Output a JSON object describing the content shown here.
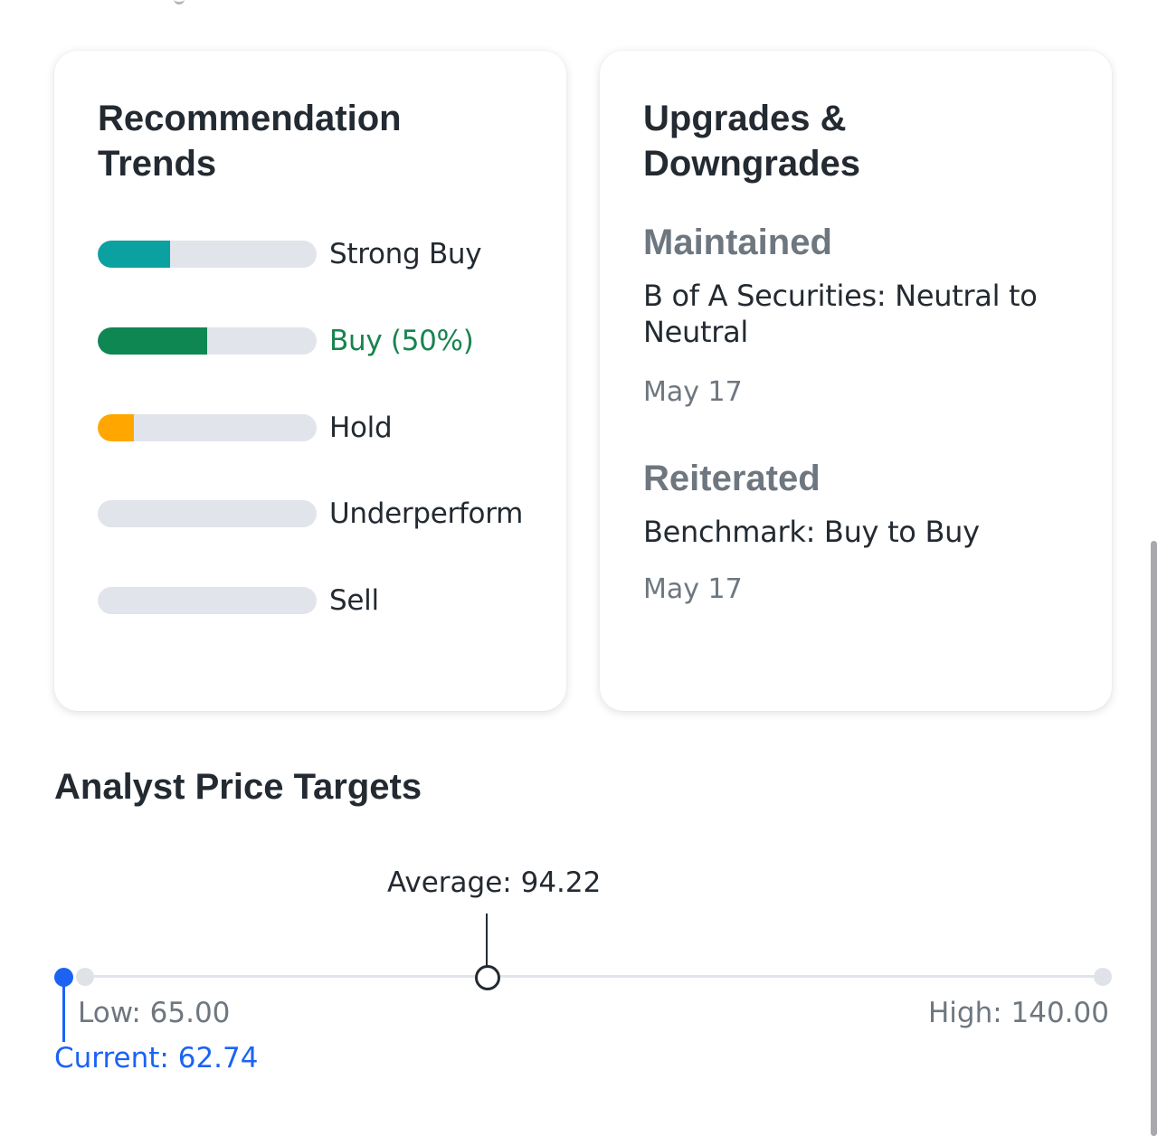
{
  "recommendation_trends": {
    "title": "Recommendation\nTrends",
    "items": [
      {
        "label": "Strong Buy",
        "fraction": 0.33,
        "color": "#0ba1a1",
        "active": false
      },
      {
        "label": "Buy (50%)",
        "fraction": 0.5,
        "color": "#0f8752",
        "active": true
      },
      {
        "label": "Hold",
        "fraction": 0.165,
        "color": "#ffa700",
        "active": false
      },
      {
        "label": "Underperform",
        "fraction": 0,
        "color": "#e1e4eb",
        "active": false
      },
      {
        "label": "Sell",
        "fraction": 0,
        "color": "#e1e4eb",
        "active": false
      }
    ]
  },
  "upgrades_downgrades": {
    "title": "Upgrades &\nDowngrades",
    "entries": [
      {
        "status": "Maintained",
        "description": "B of A Securities: Neutral to Neutral",
        "date": "May 17"
      },
      {
        "status": "Reiterated",
        "description": "Benchmark: Buy to Buy",
        "date": "May 17"
      }
    ]
  },
  "price_targets": {
    "title": "Analyst Price Targets",
    "average_label": "Average: 94.22",
    "low_label": "Low: 65.00",
    "high_label": "High: 140.00",
    "current_label": "Current: 62.74",
    "low": 65.0,
    "high": 140.0,
    "average": 94.22,
    "current": 62.74
  }
}
